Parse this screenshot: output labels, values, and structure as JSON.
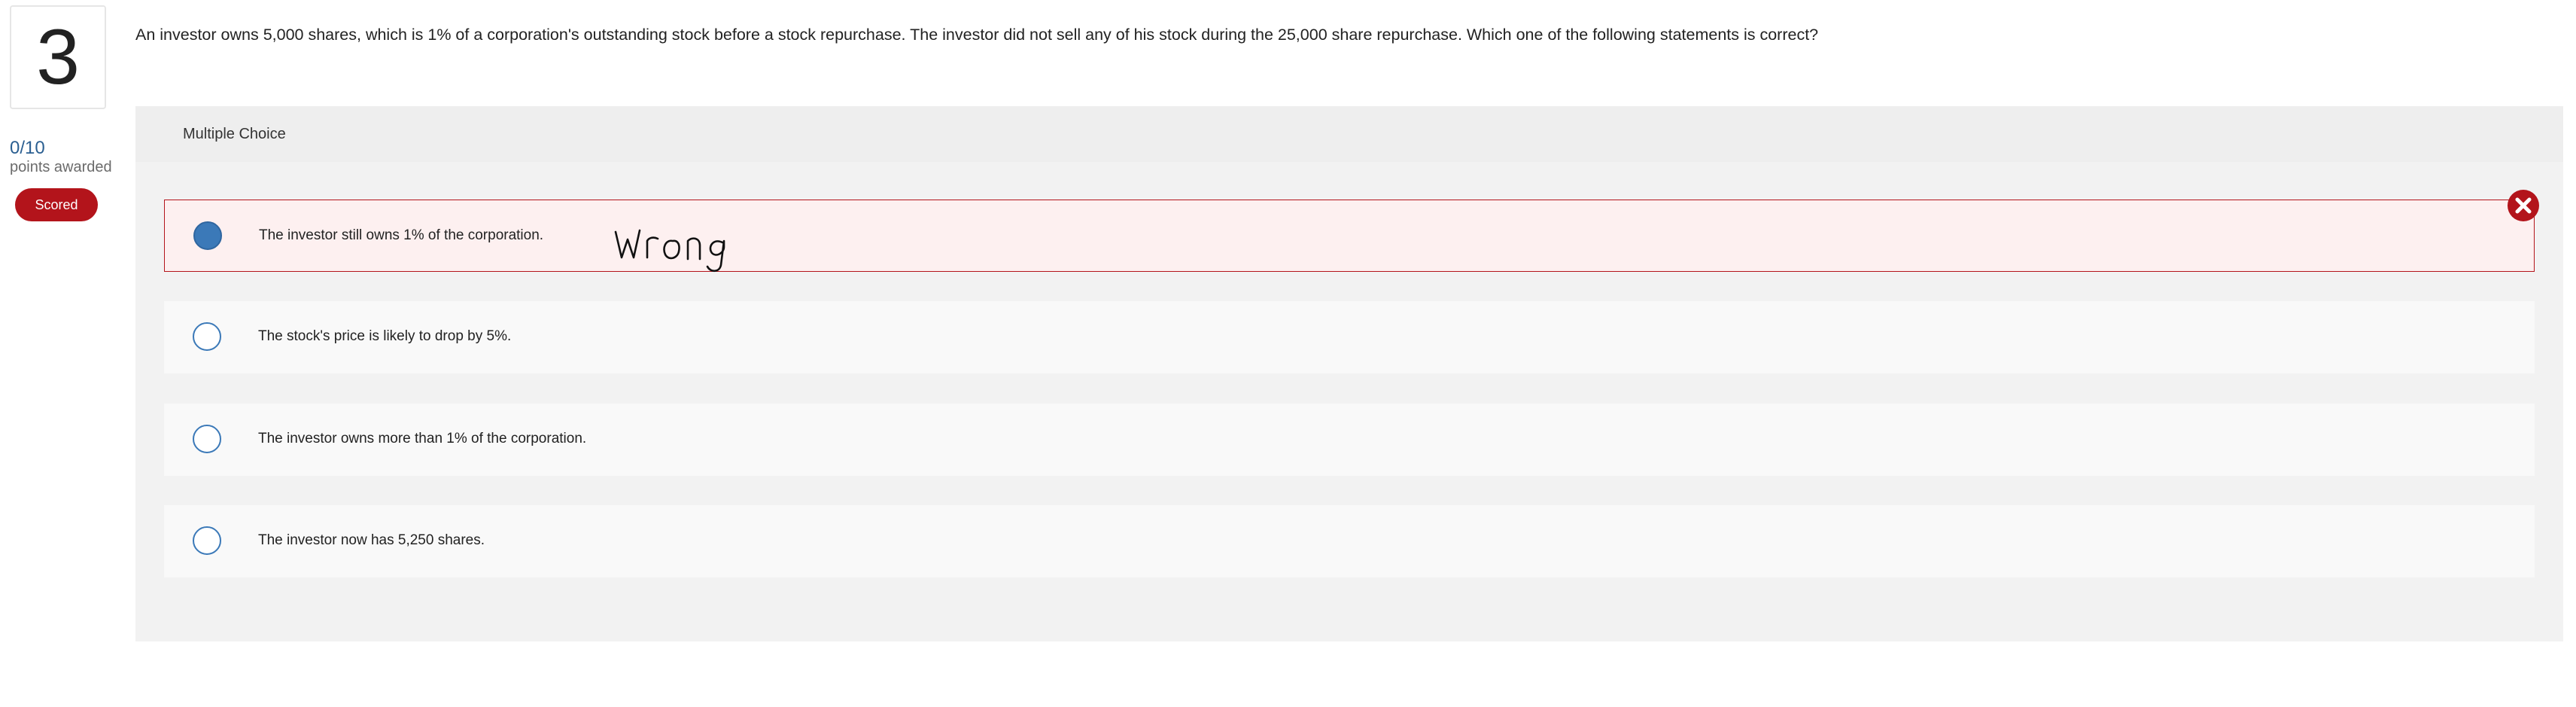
{
  "question": {
    "number": "3",
    "points": "0/10",
    "points_label": "points awarded",
    "status_badge": "Scored",
    "text": "An investor owns 5,000 shares, which is 1% of a corporation's outstanding stock before a stock repurchase. The investor did not sell any of his stock during the 25,000 share repurchase. Which one of the following statements is correct?"
  },
  "panel": {
    "type_label": "Multiple Choice"
  },
  "options": [
    {
      "label": "The investor still owns 1% of the corporation.",
      "selected": true,
      "result": "incorrect"
    },
    {
      "label": "The stock's price is likely to drop by 5%.",
      "selected": false
    },
    {
      "label": "The investor owns more than 1% of the corporation.",
      "selected": false
    },
    {
      "label": "The investor now has 5,250 shares.",
      "selected": false
    }
  ],
  "annotation": {
    "handwritten_text": "wrong"
  },
  "icons": {
    "incorrect_marker": "close-circle-icon"
  },
  "colors": {
    "accent_blue": "#3b79b8",
    "error_red": "#b3141b",
    "score_blue": "#2b5f91",
    "wrong_bg": "#fdf0f0"
  }
}
